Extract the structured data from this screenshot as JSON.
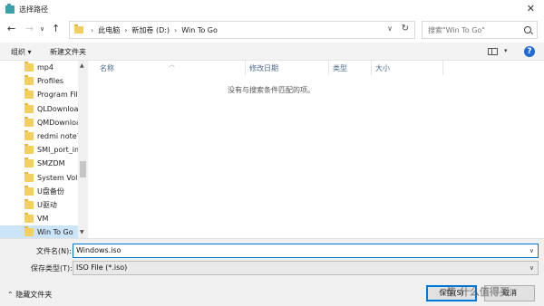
{
  "window": {
    "title": "选择路径"
  },
  "address": {
    "crumbs": [
      "此电脑",
      "新加卷 (D:)",
      "Win To Go"
    ],
    "separator": "›"
  },
  "search": {
    "placeholder": "搜索\"Win To Go\""
  },
  "toolbar": {
    "organize": "组织 ▾",
    "new_folder": "新建文件夹"
  },
  "nav": {
    "items": [
      {
        "label": "mp4"
      },
      {
        "label": "Profiles"
      },
      {
        "label": "Program File"
      },
      {
        "label": "QLDownload"
      },
      {
        "label": "QMDownloa"
      },
      {
        "label": "redmi note7"
      },
      {
        "label": "SMI_port_inf"
      },
      {
        "label": "SMZDM"
      },
      {
        "label": "System Volur"
      },
      {
        "label": "U盘备份"
      },
      {
        "label": "U驱动"
      },
      {
        "label": "VM"
      },
      {
        "label": "Win To Go"
      }
    ],
    "selected": "Win To Go"
  },
  "columns": {
    "name": "名称",
    "modified": "修改日期",
    "type": "类型",
    "size": "大小"
  },
  "empty_message": "没有与搜索条件匹配的项。",
  "file_name": {
    "label": "文件名(N):",
    "value": "Windows.iso"
  },
  "file_type": {
    "label": "保存类型(T):",
    "value": "ISO File (*.iso)"
  },
  "hide_folders": "隐藏文件夹",
  "buttons": {
    "save": "保存(S)",
    "cancel": "取消"
  },
  "watermark": "值 什么值得买",
  "colors": {
    "accent": "#0078d7",
    "selection": "#cce4f7",
    "folder": "#f3cf5f"
  }
}
